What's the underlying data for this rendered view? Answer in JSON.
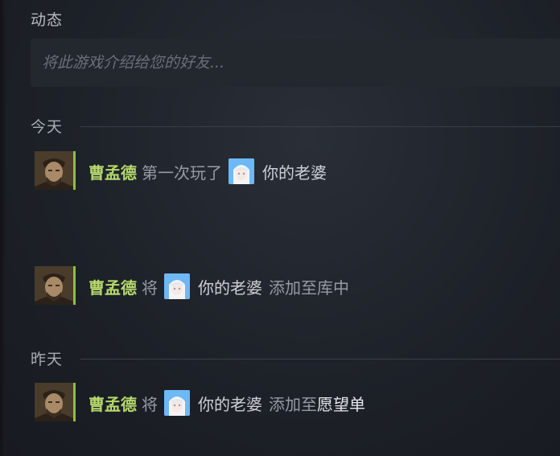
{
  "section": {
    "title": "动态"
  },
  "comment": {
    "placeholder": "将此游戏介绍给您的好友..."
  },
  "groups": [
    {
      "label": "今天",
      "items": [
        {
          "user": "曹孟德",
          "verb": "第一次玩了",
          "game": "你的老婆",
          "tail": "",
          "tail_strong": ""
        },
        {
          "user": "曹孟德",
          "verb": "将",
          "game": "你的老婆",
          "tail": "添加至库中",
          "tail_strong": ""
        }
      ]
    },
    {
      "label": "昨天",
      "items": [
        {
          "user": "曹孟德",
          "verb": "将",
          "game": "你的老婆",
          "tail": "添加至",
          "tail_strong": "愿望单"
        }
      ]
    }
  ],
  "icons": {
    "avatar": "warrior-avatar-icon",
    "game": "anime-girl-game-icon"
  },
  "colors": {
    "user_name": "#b5d86a",
    "online_bar": "#8fbf3a",
    "background": "#1d2128"
  }
}
